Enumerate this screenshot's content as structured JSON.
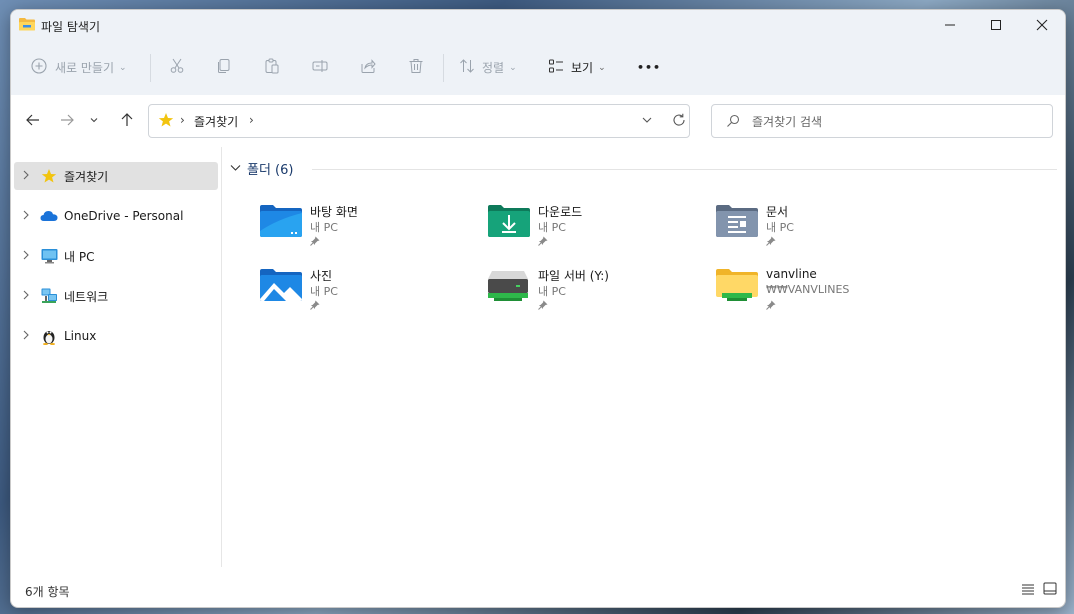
{
  "window": {
    "title": "파일 탐색기"
  },
  "toolbar": {
    "new_label": "새로 만들기",
    "sort_label": "정렬",
    "view_label": "보기",
    "more_label": "•••"
  },
  "address": {
    "segment": "즐겨찾기",
    "separator": "›"
  },
  "search": {
    "placeholder": "즐겨찾기 검색"
  },
  "sidebar": {
    "items": [
      {
        "label": "즐겨찾기",
        "icon": "star-icon"
      },
      {
        "label": "OneDrive - Personal",
        "icon": "cloud-icon"
      },
      {
        "label": "내 PC",
        "icon": "monitor-icon"
      },
      {
        "label": "네트워크",
        "icon": "network-icon"
      },
      {
        "label": "Linux",
        "icon": "linux-penguin-icon"
      }
    ]
  },
  "content": {
    "group_label": "폴더 (6)",
    "tiles": [
      {
        "name": "바탕 화면",
        "sub": "내 PC",
        "icon": "desktop-folder-icon"
      },
      {
        "name": "다운로드",
        "sub": "내 PC",
        "icon": "downloads-folder-icon"
      },
      {
        "name": "문서",
        "sub": "내 PC",
        "icon": "documents-folder-icon"
      },
      {
        "name": "사진",
        "sub": "내 PC",
        "icon": "pictures-folder-icon"
      },
      {
        "name": "파일 서버 (Y:)",
        "sub": "내 PC",
        "icon": "network-drive-icon"
      },
      {
        "name": "vanvline",
        "sub": "₩₩VANVLINES",
        "icon": "network-folder-icon"
      }
    ]
  },
  "status": {
    "count": "6개 항목"
  },
  "colors": {
    "accent": "#0067c0",
    "titlebar": "#eef2f7",
    "selected": "#e1e1e1"
  }
}
